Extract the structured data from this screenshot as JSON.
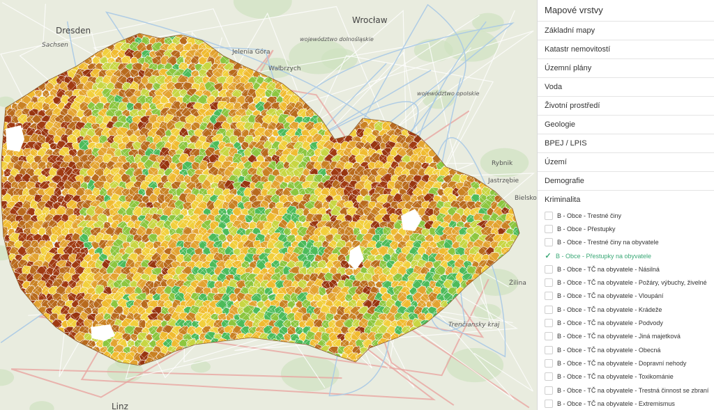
{
  "map": {
    "city_labels": [
      "Dresden",
      "Wrocław",
      "Linz"
    ],
    "place_labels": [
      "Jelenia Góra",
      "Wałbrzych",
      "Sachsen",
      "województwo dolnośląskie",
      "województwo opolskie",
      "Bielsko",
      "Jastrzębie",
      "Żilina",
      "Trenčiansky kraj",
      "Rybnik"
    ],
    "choropleth_colors": [
      "#4cbb5a",
      "#8cc63f",
      "#c8d643",
      "#f2cf3c",
      "#f0bb30",
      "#e3a331",
      "#c98123",
      "#b86a1d",
      "#983510",
      "#a03a12"
    ],
    "water_color": "#a9c9e6",
    "forest_color": "#cfe3c0",
    "highway_color": "#e8a5a0"
  },
  "panel": {
    "title": "Mapové vrstvy",
    "categories": [
      "Základní mapy",
      "Katastr nemovitostí",
      "Územní plány",
      "Voda",
      "Životní prostředí",
      "Geologie",
      "BPEJ / LPIS",
      "Území",
      "Demografie",
      "Kriminalita"
    ],
    "layers": [
      {
        "label": "B - Obce - Trestné činy",
        "checked": false
      },
      {
        "label": "B - Obce - Přestupky",
        "checked": false
      },
      {
        "label": "B - Obce - Trestné činy na obyvatele",
        "checked": false
      },
      {
        "label": "B - Obce - Přestupky na obyvatele",
        "checked": true
      },
      {
        "label": "B - Obce - TČ na obyvatele - Násilná",
        "checked": false
      },
      {
        "label": "B - Obce - TČ na obyvatele - Požáry, výbuchy, živelné",
        "checked": false
      },
      {
        "label": "B - Obce - TČ na obyvatele - Vloupání",
        "checked": false
      },
      {
        "label": "B - Obce - TČ na obyvatele - Krádeže",
        "checked": false
      },
      {
        "label": "B - Obce - TČ na obyvatele - Podvody",
        "checked": false
      },
      {
        "label": "B - Obce - TČ na obyvatele - Jiná majetková",
        "checked": false
      },
      {
        "label": "B - Obce - TČ na obyvatele - Obecná",
        "checked": false
      },
      {
        "label": "B - Obce - TČ na obyvatele - Dopravní nehody",
        "checked": false
      },
      {
        "label": "B - Obce - TČ na obyvatele - Toxikománie",
        "checked": false
      },
      {
        "label": "B - Obce - TČ na obyvatele - Trestná činnost se zbraní",
        "checked": false
      },
      {
        "label": "B - Obce - TČ na obyvatele - Extremismus",
        "checked": false
      }
    ],
    "accent_color": "#3aa876"
  }
}
